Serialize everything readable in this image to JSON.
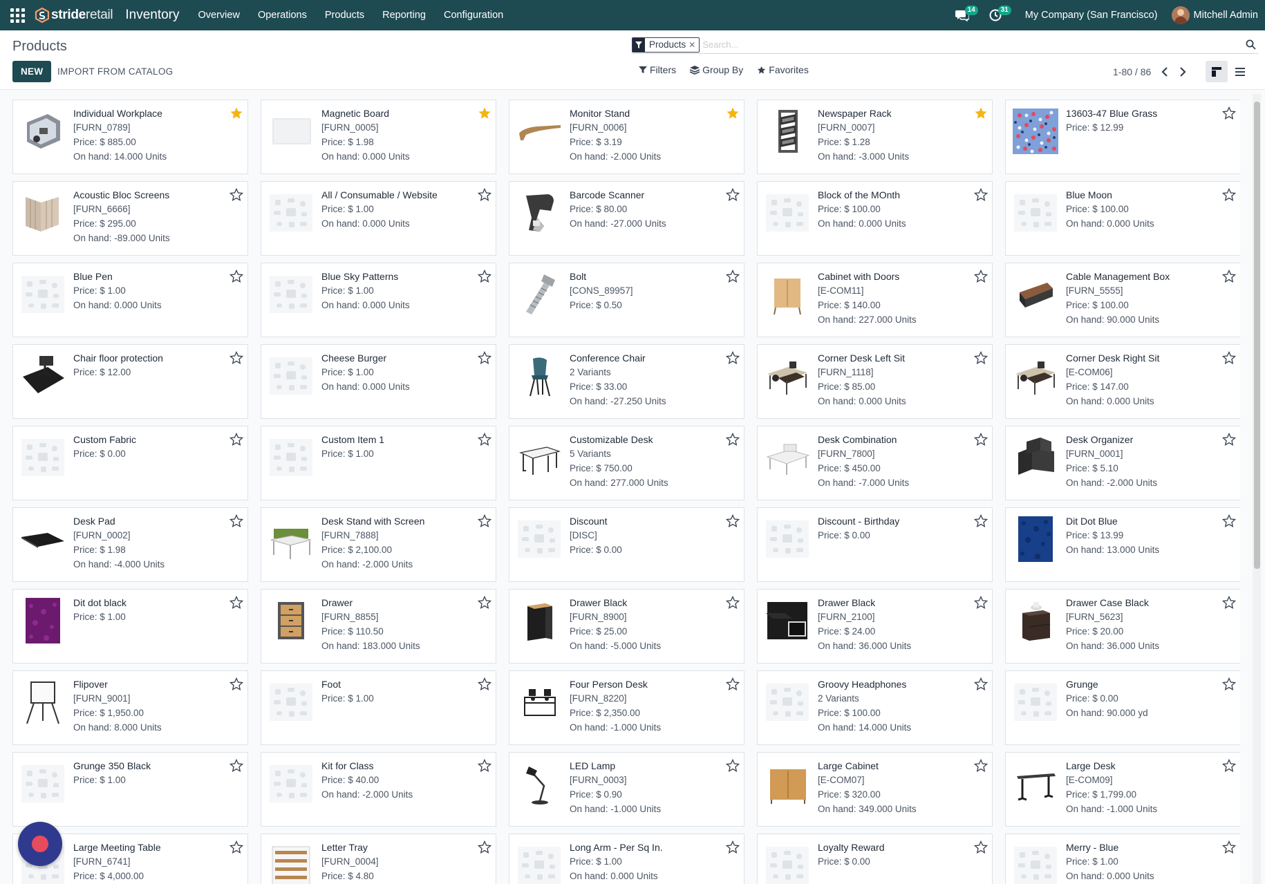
{
  "navbar": {
    "brand_bold": "stride",
    "brand_light": "retail",
    "app_title": "Inventory",
    "menu": [
      "Overview",
      "Operations",
      "Products",
      "Reporting",
      "Configuration"
    ],
    "messages_count": "14",
    "activities_count": "31",
    "company": "My Company (San Francisco)",
    "user": "Mitchell Admin"
  },
  "control": {
    "breadcrumb": "Products",
    "new_label": "NEW",
    "import_label": "IMPORT FROM CATALOG",
    "search_facet": "Products",
    "search_placeholder": "Search...",
    "filters_label": "Filters",
    "groupby_label": "Group By",
    "favorites_label": "Favorites",
    "pager": "1-80 / 86"
  },
  "colors": {
    "navbar": "#1e4a52",
    "favorite_star": "#f3b515",
    "accent": "#17a589"
  },
  "products": [
    {
      "name": "Individual Workplace",
      "lines": [
        "[FURN_0789]",
        "Price: $ 885.00",
        "On hand: 14.000 Units"
      ],
      "fav": true,
      "img": "workplace"
    },
    {
      "name": "Magnetic Board",
      "lines": [
        "[FURN_0005]",
        "Price: $ 1.98",
        "On hand: 0.000 Units"
      ],
      "fav": true,
      "img": "board"
    },
    {
      "name": "Monitor Stand",
      "lines": [
        "[FURN_0006]",
        "Price: $ 3.19",
        "On hand: -2.000 Units"
      ],
      "fav": true,
      "img": "monitorstand"
    },
    {
      "name": "Newspaper Rack",
      "lines": [
        "[FURN_0007]",
        "Price: $ 1.28",
        "On hand: -3.000 Units"
      ],
      "fav": true,
      "img": "rack"
    },
    {
      "name": "13603-47 Blue Grass",
      "lines": [
        "Price: $ 12.99"
      ],
      "fav": false,
      "img": "floral"
    },
    {
      "name": "Acoustic Bloc Screens",
      "lines": [
        "[FURN_6666]",
        "Price: $ 295.00",
        "On hand: -89.000 Units"
      ],
      "fav": false,
      "img": "screens"
    },
    {
      "name": "All / Consumable / Website",
      "lines": [
        "Price: $ 1.00",
        "On hand: 0.000 Units"
      ],
      "fav": false,
      "img": "placeholder"
    },
    {
      "name": "Barcode Scanner",
      "lines": [
        "Price: $ 80.00",
        "On hand: -27.000 Units"
      ],
      "fav": false,
      "img": "scanner"
    },
    {
      "name": "Block of the MOnth",
      "lines": [
        "Price: $ 100.00",
        "On hand: 0.000 Units"
      ],
      "fav": false,
      "img": "placeholder"
    },
    {
      "name": "Blue Moon",
      "lines": [
        "Price: $ 100.00",
        "On hand: 0.000 Units"
      ],
      "fav": false,
      "img": "placeholder"
    },
    {
      "name": "Blue Pen",
      "lines": [
        "Price: $ 1.00",
        "On hand: 0.000 Units"
      ],
      "fav": false,
      "img": "placeholder"
    },
    {
      "name": "Blue Sky Patterns",
      "lines": [
        "Price: $ 1.00",
        "On hand: 0.000 Units"
      ],
      "fav": false,
      "img": "placeholder"
    },
    {
      "name": "Bolt",
      "lines": [
        "[CONS_89957]",
        "Price: $ 0.50"
      ],
      "fav": false,
      "img": "bolt"
    },
    {
      "name": "Cabinet with Doors",
      "lines": [
        "[E-COM11]",
        "Price: $ 140.00",
        "On hand: 227.000 Units"
      ],
      "fav": false,
      "img": "cabinet"
    },
    {
      "name": "Cable Management Box",
      "lines": [
        "[FURN_5555]",
        "Price: $ 100.00",
        "On hand: 90.000 Units"
      ],
      "fav": false,
      "img": "cablebox"
    },
    {
      "name": "Chair floor protection",
      "lines": [
        "Price: $ 12.00"
      ],
      "fav": false,
      "img": "floormat"
    },
    {
      "name": "Cheese Burger",
      "lines": [
        "Price: $ 1.00",
        "On hand: 0.000 Units"
      ],
      "fav": false,
      "img": "placeholder"
    },
    {
      "name": "Conference Chair",
      "lines": [
        "2 Variants",
        "Price: $ 33.00",
        "On hand: -27.250 Units"
      ],
      "fav": false,
      "img": "chair"
    },
    {
      "name": "Corner Desk Left Sit",
      "lines": [
        "[FURN_1118]",
        "Price: $ 85.00",
        "On hand: 0.000 Units"
      ],
      "fav": false,
      "img": "cornerdesk"
    },
    {
      "name": "Corner Desk Right Sit",
      "lines": [
        "[E-COM06]",
        "Price: $ 147.00",
        "On hand: 0.000 Units"
      ],
      "fav": false,
      "img": "cornerdesk"
    },
    {
      "name": "Custom Fabric",
      "lines": [
        "Price: $ 0.00"
      ],
      "fav": false,
      "img": "placeholder"
    },
    {
      "name": "Custom Item 1",
      "lines": [
        "Price: $ 1.00"
      ],
      "fav": false,
      "img": "placeholder"
    },
    {
      "name": "Customizable Desk",
      "lines": [
        "5 Variants",
        "Price: $ 750.00",
        "On hand: 277.000 Units"
      ],
      "fav": false,
      "img": "desk"
    },
    {
      "name": "Desk Combination",
      "lines": [
        "[FURN_7800]",
        "Price: $ 450.00",
        "On hand: -7.000 Units"
      ],
      "fav": false,
      "img": "deskcombo"
    },
    {
      "name": "Desk Organizer",
      "lines": [
        "[FURN_0001]",
        "Price: $ 5.10",
        "On hand: -2.000 Units"
      ],
      "fav": false,
      "img": "organizer"
    },
    {
      "name": "Desk Pad",
      "lines": [
        "[FURN_0002]",
        "Price: $ 1.98",
        "On hand: -4.000 Units"
      ],
      "fav": false,
      "img": "deskpad"
    },
    {
      "name": "Desk Stand with Screen",
      "lines": [
        "[FURN_7888]",
        "Price: $ 2,100.00",
        "On hand: -2.000 Units"
      ],
      "fav": false,
      "img": "deskstand"
    },
    {
      "name": "Discount",
      "lines": [
        "[DISC]",
        "Price: $ 0.00"
      ],
      "fav": false,
      "img": "placeholder"
    },
    {
      "name": "Discount - Birthday",
      "lines": [
        "Price: $ 0.00"
      ],
      "fav": false,
      "img": "placeholder"
    },
    {
      "name": "Dit Dot Blue",
      "lines": [
        "Price: $ 13.99",
        "On hand: 13.000 Units"
      ],
      "fav": false,
      "img": "bluefabric"
    },
    {
      "name": "Dit dot black",
      "lines": [
        "Price: $ 1.00"
      ],
      "fav": false,
      "img": "purplefabric"
    },
    {
      "name": "Drawer",
      "lines": [
        "[FURN_8855]",
        "Price: $ 110.50",
        "On hand: 183.000 Units"
      ],
      "fav": false,
      "img": "drawer"
    },
    {
      "name": "Drawer Black",
      "lines": [
        "[FURN_8900]",
        "Price: $ 25.00",
        "On hand: -5.000 Units"
      ],
      "fav": false,
      "img": "drawerblack"
    },
    {
      "name": "Drawer Black",
      "lines": [
        "[FURN_2100]",
        "Price: $ 24.00",
        "On hand: 36.000 Units"
      ],
      "fav": false,
      "img": "drawerblack2"
    },
    {
      "name": "Drawer Case Black",
      "lines": [
        "[FURN_5623]",
        "Price: $ 20.00",
        "On hand: 36.000 Units"
      ],
      "fav": false,
      "img": "drawercase"
    },
    {
      "name": "Flipover",
      "lines": [
        "[FURN_9001]",
        "Price: $ 1,950.00",
        "On hand: 8.000 Units"
      ],
      "fav": false,
      "img": "flipover"
    },
    {
      "name": "Foot",
      "lines": [
        "Price: $ 1.00"
      ],
      "fav": false,
      "img": "placeholder"
    },
    {
      "name": "Four Person Desk",
      "lines": [
        "[FURN_8220]",
        "Price: $ 2,350.00",
        "On hand: -1.000 Units"
      ],
      "fav": false,
      "img": "fourdesk"
    },
    {
      "name": "Groovy Headphones",
      "lines": [
        "2 Variants",
        "Price: $ 100.00",
        "On hand: 14.000 Units"
      ],
      "fav": false,
      "img": "placeholder"
    },
    {
      "name": "Grunge",
      "lines": [
        "Price: $ 0.00",
        "On hand: 90.000 yd"
      ],
      "fav": false,
      "img": "placeholder"
    },
    {
      "name": "Grunge 350 Black",
      "lines": [
        "Price: $ 1.00"
      ],
      "fav": false,
      "img": "placeholder"
    },
    {
      "name": "Kit for Class",
      "lines": [
        "Price: $ 40.00",
        "On hand: -2.000 Units"
      ],
      "fav": false,
      "img": "placeholder"
    },
    {
      "name": "LED Lamp",
      "lines": [
        "[FURN_0003]",
        "Price: $ 0.90",
        "On hand: -1.000 Units"
      ],
      "fav": false,
      "img": "lamp"
    },
    {
      "name": "Large Cabinet",
      "lines": [
        "[E-COM07]",
        "Price: $ 320.00",
        "On hand: 349.000 Units"
      ],
      "fav": false,
      "img": "largecabinet"
    },
    {
      "name": "Large Desk",
      "lines": [
        "[E-COM09]",
        "Price: $ 1,799.00",
        "On hand: -1.000 Units"
      ],
      "fav": false,
      "img": "largedesk"
    },
    {
      "name": "Large Meeting Table",
      "lines": [
        "[FURN_6741]",
        "Price: $ 4,000.00"
      ],
      "fav": false,
      "img": "placeholder"
    },
    {
      "name": "Letter Tray",
      "lines": [
        "[FURN_0004]",
        "Price: $ 4.80"
      ],
      "fav": false,
      "img": "lettertray"
    },
    {
      "name": "Long Arm - Per Sq In.",
      "lines": [
        "Price: $ 1.00",
        "On hand: 0.000 Units"
      ],
      "fav": false,
      "img": "placeholder"
    },
    {
      "name": "Loyalty Reward",
      "lines": [
        "Price: $ 0.00"
      ],
      "fav": false,
      "img": "placeholder"
    },
    {
      "name": "Merry - Blue",
      "lines": [
        "Price: $ 1.00",
        "On hand: 0.000 Units"
      ],
      "fav": false,
      "img": "placeholder"
    }
  ]
}
